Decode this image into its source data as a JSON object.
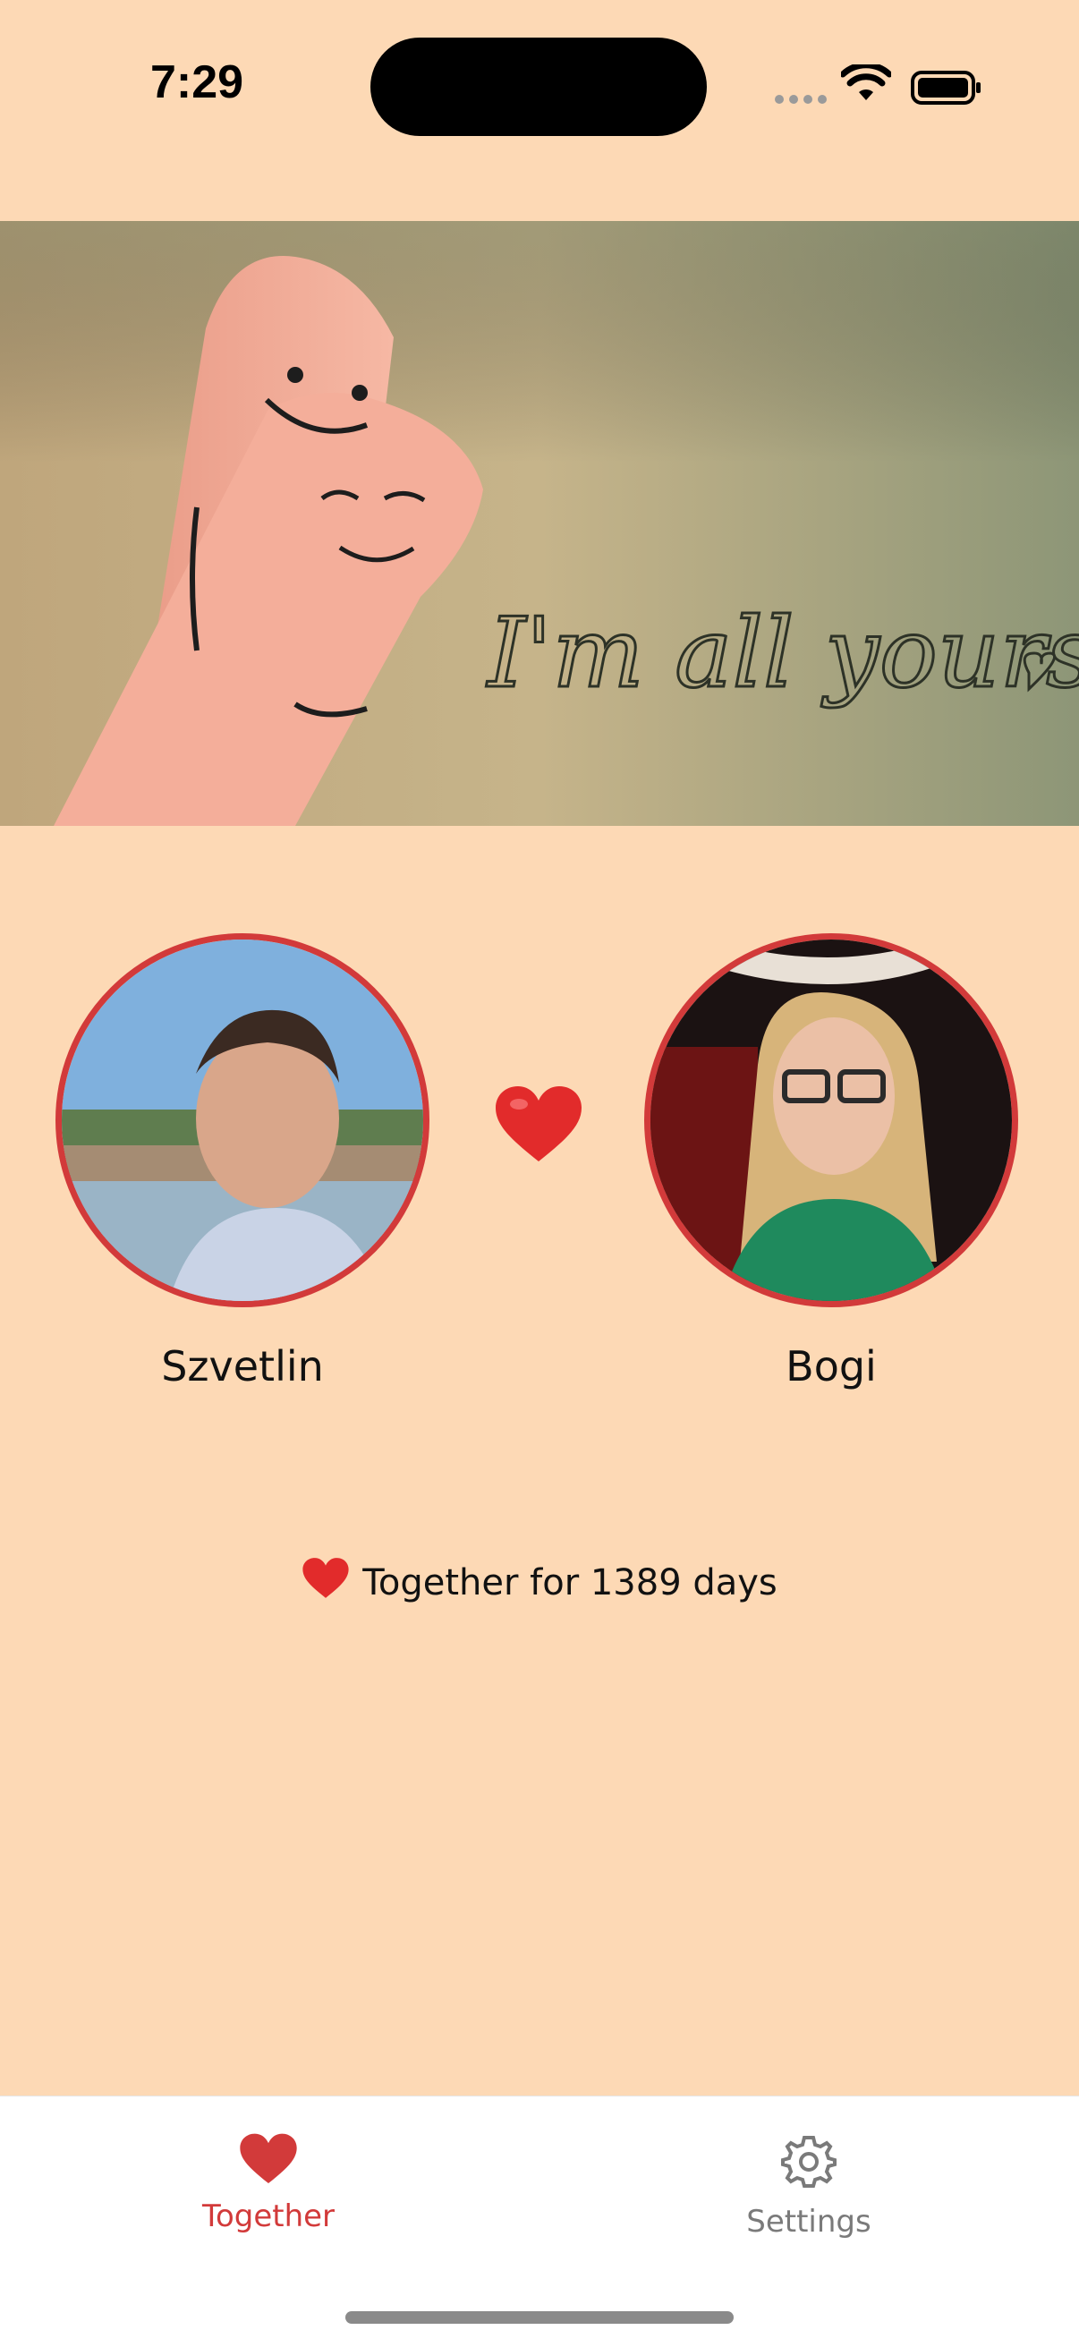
{
  "status_bar": {
    "time": "7:29"
  },
  "hero": {
    "handwriting": "I'm all yours"
  },
  "partners": {
    "left": {
      "name": "Szvetlin"
    },
    "right": {
      "name": "Bogi"
    }
  },
  "together": {
    "text": "Together for 1389 days"
  },
  "tab_bar": {
    "tabs": [
      {
        "label": "Together",
        "icon": "heart-icon",
        "active": true
      },
      {
        "label": "Settings",
        "icon": "gear-icon",
        "active": false
      }
    ]
  },
  "colors": {
    "background": "#FDD9B5",
    "accent": "#D23A3A",
    "inactive_tab": "#7a7a7a"
  }
}
